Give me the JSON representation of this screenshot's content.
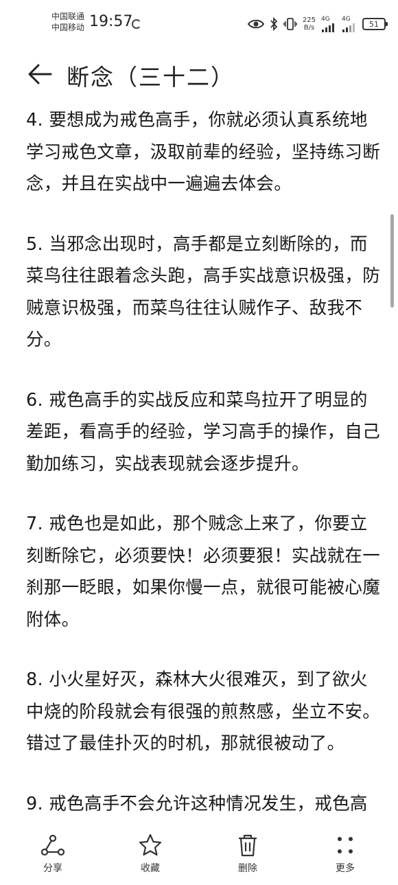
{
  "status_bar": {
    "carrier_1": "中国联通",
    "carrier_2": "中国移动",
    "time": "19:57",
    "speed_value": "225",
    "speed_unit": "B/s",
    "net_1": "4G",
    "net_2": "4G",
    "battery": "51"
  },
  "header": {
    "title": "断念（三十二）"
  },
  "article": {
    "paragraphs": [
      "4. 要想成为戒色高手，你就必须认真系统地学习戒色文章，汲取前辈的经验，坚持练习断念，并且在实战中一遍遍去体会。",
      "5. 当邪念出现时，高手都是立刻断除的，而菜鸟往往跟着念头跑，高手实战意识极强，防贼意识极强，而菜鸟往往认贼作子、敌我不分。",
      "6. 戒色高手的实战反应和菜鸟拉开了明显的差距，看高手的经验，学习高手的操作，自己勤加练习，实战表现就会逐步提升。",
      "7. 戒色也是如此，那个贼念上来了，你要立刻断除它，必须要快！必须要狠！实战就在一刹那一眨眼，如果你慢一点，就很可能被心魔附体。",
      "8. 小火星好灭，森林大火很难灭，到了欲火中烧的阶段就会有很强的煎熬感，坐立不安。错过了最佳扑灭的时机，那就很被动了。",
      "9. 戒色高手不会允许这种情况发生，戒色高"
    ]
  },
  "toolbar": {
    "share": "分享",
    "favorite": "收藏",
    "delete": "删除",
    "more": "更多"
  }
}
